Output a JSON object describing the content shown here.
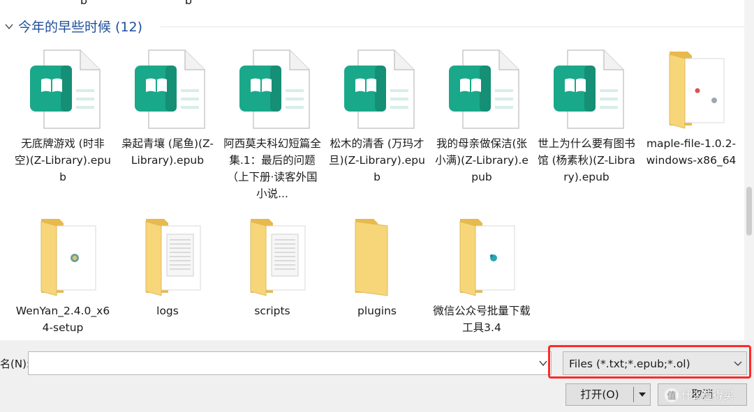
{
  "scrolled_off": {
    "label_1": "b",
    "label_2": "b"
  },
  "group": {
    "title": "今年的早些时候 (12)"
  },
  "files": [
    {
      "name": "无底牌游戏 (时非空)(Z-Library).epub",
      "icon": "epub-file-icon"
    },
    {
      "name": "枭起青壤 (尾鱼)(Z-Library).epub",
      "icon": "epub-file-icon"
    },
    {
      "name": "阿西莫夫科幻短篇全集.1：最后的问题（上下册·读客外国小说...",
      "icon": "epub-file-icon"
    },
    {
      "name": "松木的清香 (万玛才旦)(Z-Library).epub",
      "icon": "epub-file-icon"
    },
    {
      "name": "我的母亲做保洁(张小满)(Z-Library).epub",
      "icon": "epub-file-icon"
    },
    {
      "name": "世上为什么要有图书馆 (杨素秋)(Z-Library).epub",
      "icon": "epub-file-icon"
    },
    {
      "name": "maple-file-1.0.2-windows-x86_64",
      "icon": "folder-with-file-icon"
    },
    {
      "name": "WenYan_2.4.0_x64-setup",
      "icon": "folder-with-file-icon"
    },
    {
      "name": "logs",
      "icon": "folder-with-docs-icon"
    },
    {
      "name": "scripts",
      "icon": "folder-with-docs-icon"
    },
    {
      "name": "plugins",
      "icon": "folder-icon"
    },
    {
      "name": "微信公众号批量下载工具3.4",
      "icon": "folder-with-file-icon"
    }
  ],
  "bottom": {
    "filename_label": "名(N):",
    "filename_value": "",
    "filetype_value": "Files (*.txt;*.epub;*.ol)",
    "open_label": "打开(O)",
    "cancel_label": "取消"
  },
  "watermark": {
    "text": "什么值得买",
    "icon_char": "值"
  },
  "colors": {
    "epub_teal": "#1aa88a",
    "folder_yellow": "#f7d67a",
    "highlight_red": "#ff2a2a",
    "group_title": "#1f4f9a"
  }
}
